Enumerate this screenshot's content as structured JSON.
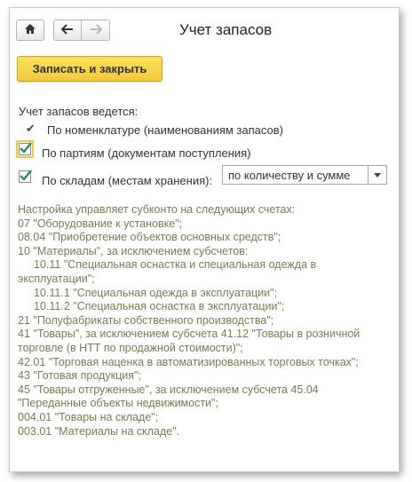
{
  "window": {
    "title": "Учет запасов"
  },
  "toolbar": {
    "home_icon": "home-icon",
    "back_icon": "arrow-left-icon",
    "forward_icon": "arrow-right-icon"
  },
  "actions": {
    "save_close_label": "Записать и закрыть"
  },
  "settings": {
    "heading": "Учет запасов ведется:",
    "by_nomenclature": "По номенклатуре (наименованиям запасов)",
    "by_batches": "По партиям (документам поступления)",
    "by_batches_checked": true,
    "by_warehouses": "По складам (местам хранения):",
    "by_warehouses_checked": true,
    "warehouse_mode": "по количеству и сумме"
  },
  "info": {
    "lines": [
      {
        "text": "Настройка управляет субконто на следующих счетах:",
        "indent": false
      },
      {
        "text": "07 \"Оборудование к установке\";",
        "indent": false
      },
      {
        "text": "08.04 \"Приобретение объектов основных средств\";",
        "indent": false
      },
      {
        "text": "10 \"Материалы\", за исключением субсчетов:",
        "indent": false
      },
      {
        "text": "10.11 \"Специальная оснастка и специальная одежда в",
        "indent": true
      },
      {
        "text": "эксплуатации\";",
        "indent": false
      },
      {
        "text": "10.11.1 \"Специальная одежда в эксплуатации\";",
        "indent": true
      },
      {
        "text": "10.11.2 \"Специальная оснастка в эксплуатации\";",
        "indent": true
      },
      {
        "text": "21 \"Полуфабрикаты собственного производства\";",
        "indent": false
      },
      {
        "text": "41 \"Товары\", за исключением субсчета 41.12 \"Товары в розничной",
        "indent": false
      },
      {
        "text": "торговле (в НТТ по продажной стоимости)\";",
        "indent": false
      },
      {
        "text": "42.01 \"Торговая наценка в автоматизированных торговых точках\";",
        "indent": false
      },
      {
        "text": "43 \"Готовая продукция\";",
        "indent": false
      },
      {
        "text": "45 \"Товары отгруженные\", за исключением субсчета 45.04",
        "indent": false
      },
      {
        "text": "\"Переданные объекты недвижимости\";",
        "indent": false
      },
      {
        "text": "004.01 \"Товары на складе\";",
        "indent": false
      },
      {
        "text": "003.01 \"Материалы на складе\".",
        "indent": false
      }
    ]
  },
  "colors": {
    "accent_yellow": "#f1c93d",
    "check_green": "#2e8b57",
    "info_text": "#7a7a50"
  }
}
